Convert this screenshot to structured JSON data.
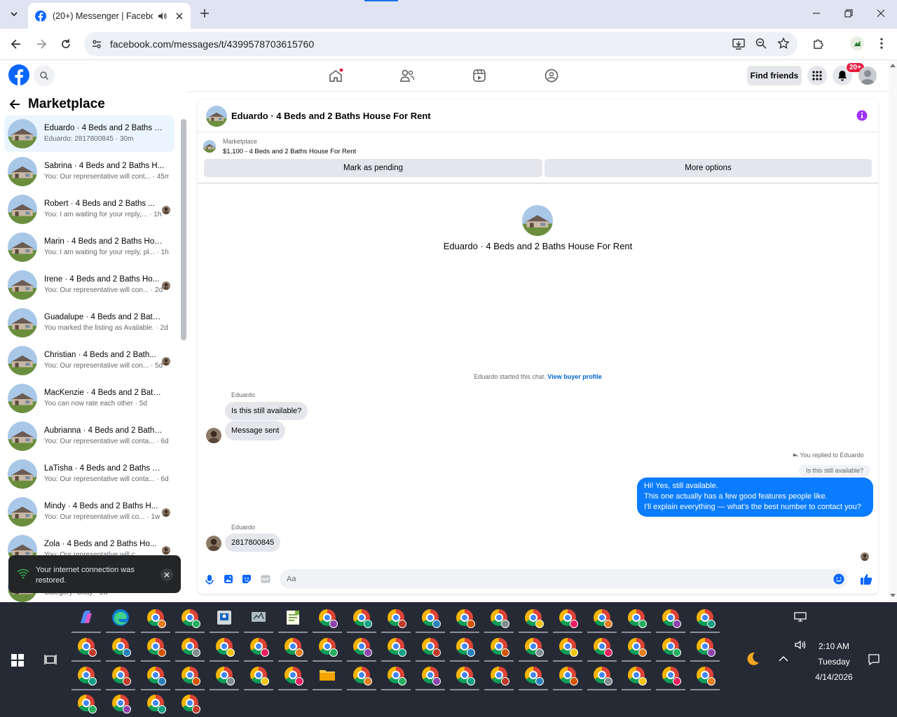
{
  "browser": {
    "tab_title": "(20+) Messenger | Facebook",
    "url": "facebook.com/messages/t/4399578703615760"
  },
  "fb": {
    "find_friends": "Find friends",
    "notif_badge": "20+"
  },
  "left": {
    "heading": "Marketplace",
    "conversations": [
      {
        "name": "Eduardo · 4 Beds and 2 Baths H...",
        "preview": "Eduardo: 2817800845 · 30m"
      },
      {
        "name": "Sabrina · 4 Beds and 2 Baths H...",
        "preview": "You: Our representative will cont... · 45m"
      },
      {
        "name": "Robert · 4 Beds and 2 Baths ...",
        "preview": "You: I am waiting for your reply,... · 1h"
      },
      {
        "name": "Marin · 4 Beds and 2 Baths Hou...",
        "preview": "You: I am waiting for your reply, pl... · 1h"
      },
      {
        "name": "Irene · 4 Beds and 2 Baths Ho...",
        "preview": "You: Our representative will con... · 2d"
      },
      {
        "name": "Guadalupe · 4 Beds and 2 Baths...",
        "preview": "You marked the listing as Available. · 2d"
      },
      {
        "name": "Christian · 4 Beds and 2 Bath...",
        "preview": "You: Our representative will con... · 5d"
      },
      {
        "name": "MacKenzie · 4 Beds and 2 Baths...",
        "preview": "You can now rate each other · 5d"
      },
      {
        "name": "Aubrianna · 4 Beds and 2 Baths ...",
        "preview": "You: Our representative will conta... · 6d"
      },
      {
        "name": "LaTisha · 4 Beds and 2 Baths Ho...",
        "preview": "You: Our representative will conta... · 6d"
      },
      {
        "name": "Mindy · 4 Beds and 2 Baths H...",
        "preview": "You: Our representative will co... · 1w"
      },
      {
        "name": "Zola · 4 Beds and 2 Baths Ho...",
        "preview": "You: Our representative will c..."
      },
      {
        "name": "",
        "preview": "Category: Okay · 1w"
      }
    ],
    "toast": "Your internet connection was restored."
  },
  "chat": {
    "title": "Eduardo · 4 Beds and 2 Baths House For Rent",
    "listing_label": "Marketplace",
    "listing_desc": "$1,100 - 4 Beds and 2 Baths House For Rent",
    "mark_pending": "Mark as pending",
    "more_options": "More options",
    "center_name": "Eduardo · 4 Beds and 2 Baths House For Rent",
    "started_text": "Eduardo started this chat.",
    "view_profile": "View buyer profile",
    "sender1": "Eduardo",
    "msg1": "Is this still available?",
    "msg2": "Message sent",
    "replied_to": "You replied to Eduardo",
    "quoted": "Is this still available?",
    "out_line1": "Hi! Yes, still available.",
    "out_line2": "This one actually has a few good features people like.",
    "out_line3": "I'll explain everything — what's the best number to contact you?",
    "sender2": "Eduardo",
    "msg3": "2817800845",
    "composer_placeholder": "Aa"
  },
  "taskbar": {
    "time": "2:10 AM",
    "day": "Tuesday",
    "date": "4/14/2026"
  }
}
